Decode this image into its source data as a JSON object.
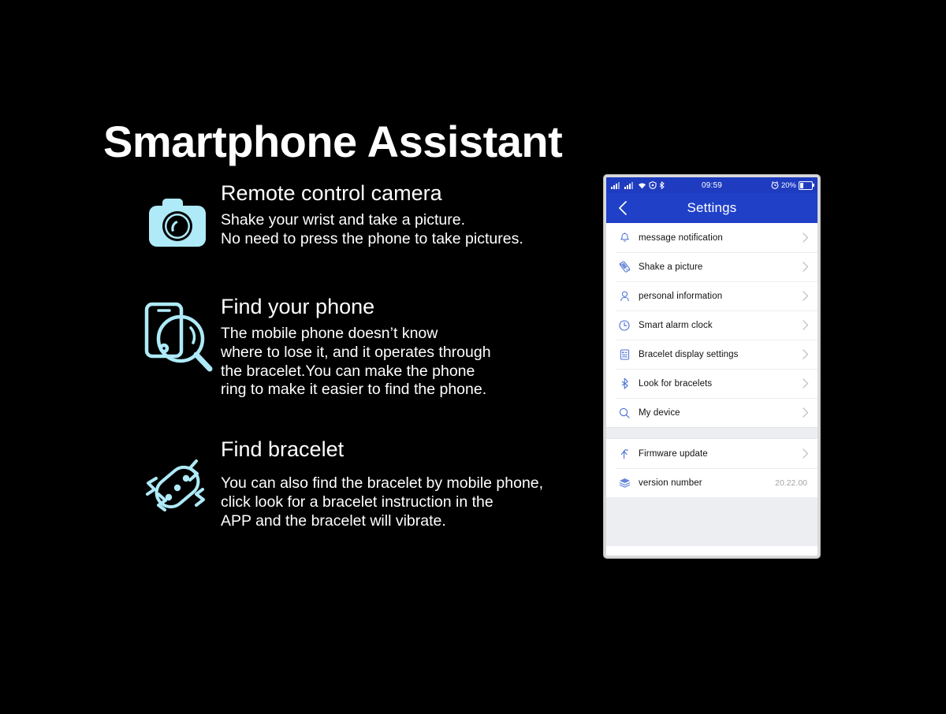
{
  "page": {
    "title": "Smartphone Assistant",
    "background_color": "#000000",
    "accent_icon_color": "#aeeaf7"
  },
  "features": [
    {
      "icon": "camera-icon",
      "title": "Remote control camera",
      "description": "Shake your wrist and take a picture.\nNo need to press the phone to take pictures."
    },
    {
      "icon": "find-phone-magnifier-icon",
      "title": "Find your phone",
      "description": "The mobile phone doesn’t know\nwhere to lose it, and it operates through\nthe bracelet.You can make the phone\nring to make it easier to find the phone."
    },
    {
      "icon": "vibrating-bracelet-icon",
      "title": "Find bracelet",
      "description": "You can also find the bracelet by mobile phone,\n click  look for a bracelet instruction in the\nAPP and the bracelet will vibrate."
    }
  ],
  "phone": {
    "status_bar": {
      "signal_icon": "signal-bars-icon",
      "signal_icon_2": "signal-bars-icon-2",
      "wifi_icon": "wifi-icon",
      "vpn_icon": "vpn-shield-icon",
      "bluetooth_icon": "bluetooth-status-icon",
      "time": "09:59",
      "alarm_icon": "alarm-clock-icon",
      "battery_percent": "20%",
      "battery_icon": "battery-icon"
    },
    "nav": {
      "back_icon": "chevron-left-icon",
      "title": "Settings",
      "header_color": "#2040c8"
    },
    "groups": [
      {
        "rows": [
          {
            "icon": "bell-icon",
            "label": "message notification",
            "value": "",
            "chevron": true
          },
          {
            "icon": "shake-phone-icon",
            "label": "Shake a picture",
            "value": "",
            "chevron": true
          },
          {
            "icon": "person-icon",
            "label": "personal information",
            "value": "",
            "chevron": true
          },
          {
            "icon": "clock-icon",
            "label": "Smart alarm clock",
            "value": "",
            "chevron": true
          },
          {
            "icon": "display-list-icon",
            "label": "Bracelet display settings",
            "value": "",
            "chevron": true
          },
          {
            "icon": "bluetooth-icon",
            "label": "Look for bracelets",
            "value": "",
            "chevron": true
          },
          {
            "icon": "search-icon",
            "label": "My device",
            "value": "",
            "chevron": true
          }
        ]
      },
      {
        "rows": [
          {
            "icon": "firmware-update-icon",
            "label": "Firmware update",
            "value": "",
            "chevron": true
          },
          {
            "icon": "layers-icon",
            "label": "version number",
            "value": "20.22.00",
            "chevron": false
          }
        ]
      }
    ]
  }
}
